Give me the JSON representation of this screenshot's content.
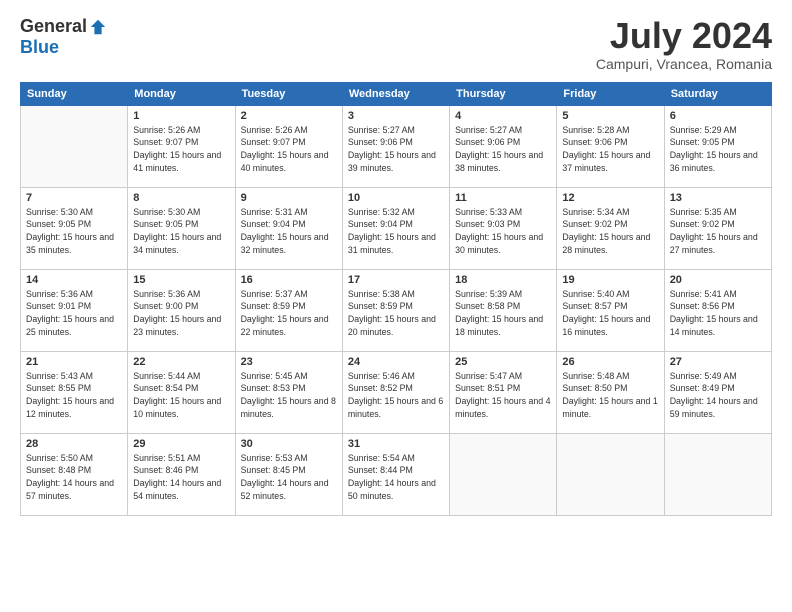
{
  "logo": {
    "general": "General",
    "blue": "Blue"
  },
  "title": "July 2024",
  "subtitle": "Campuri, Vrancea, Romania",
  "days_of_week": [
    "Sunday",
    "Monday",
    "Tuesday",
    "Wednesday",
    "Thursday",
    "Friday",
    "Saturday"
  ],
  "weeks": [
    [
      {
        "day": "",
        "sunrise": "",
        "sunset": "",
        "daylight": ""
      },
      {
        "day": "1",
        "sunrise": "Sunrise: 5:26 AM",
        "sunset": "Sunset: 9:07 PM",
        "daylight": "Daylight: 15 hours and 41 minutes."
      },
      {
        "day": "2",
        "sunrise": "Sunrise: 5:26 AM",
        "sunset": "Sunset: 9:07 PM",
        "daylight": "Daylight: 15 hours and 40 minutes."
      },
      {
        "day": "3",
        "sunrise": "Sunrise: 5:27 AM",
        "sunset": "Sunset: 9:06 PM",
        "daylight": "Daylight: 15 hours and 39 minutes."
      },
      {
        "day": "4",
        "sunrise": "Sunrise: 5:27 AM",
        "sunset": "Sunset: 9:06 PM",
        "daylight": "Daylight: 15 hours and 38 minutes."
      },
      {
        "day": "5",
        "sunrise": "Sunrise: 5:28 AM",
        "sunset": "Sunset: 9:06 PM",
        "daylight": "Daylight: 15 hours and 37 minutes."
      },
      {
        "day": "6",
        "sunrise": "Sunrise: 5:29 AM",
        "sunset": "Sunset: 9:05 PM",
        "daylight": "Daylight: 15 hours and 36 minutes."
      }
    ],
    [
      {
        "day": "7",
        "sunrise": "Sunrise: 5:30 AM",
        "sunset": "Sunset: 9:05 PM",
        "daylight": "Daylight: 15 hours and 35 minutes."
      },
      {
        "day": "8",
        "sunrise": "Sunrise: 5:30 AM",
        "sunset": "Sunset: 9:05 PM",
        "daylight": "Daylight: 15 hours and 34 minutes."
      },
      {
        "day": "9",
        "sunrise": "Sunrise: 5:31 AM",
        "sunset": "Sunset: 9:04 PM",
        "daylight": "Daylight: 15 hours and 32 minutes."
      },
      {
        "day": "10",
        "sunrise": "Sunrise: 5:32 AM",
        "sunset": "Sunset: 9:04 PM",
        "daylight": "Daylight: 15 hours and 31 minutes."
      },
      {
        "day": "11",
        "sunrise": "Sunrise: 5:33 AM",
        "sunset": "Sunset: 9:03 PM",
        "daylight": "Daylight: 15 hours and 30 minutes."
      },
      {
        "day": "12",
        "sunrise": "Sunrise: 5:34 AM",
        "sunset": "Sunset: 9:02 PM",
        "daylight": "Daylight: 15 hours and 28 minutes."
      },
      {
        "day": "13",
        "sunrise": "Sunrise: 5:35 AM",
        "sunset": "Sunset: 9:02 PM",
        "daylight": "Daylight: 15 hours and 27 minutes."
      }
    ],
    [
      {
        "day": "14",
        "sunrise": "Sunrise: 5:36 AM",
        "sunset": "Sunset: 9:01 PM",
        "daylight": "Daylight: 15 hours and 25 minutes."
      },
      {
        "day": "15",
        "sunrise": "Sunrise: 5:36 AM",
        "sunset": "Sunset: 9:00 PM",
        "daylight": "Daylight: 15 hours and 23 minutes."
      },
      {
        "day": "16",
        "sunrise": "Sunrise: 5:37 AM",
        "sunset": "Sunset: 8:59 PM",
        "daylight": "Daylight: 15 hours and 22 minutes."
      },
      {
        "day": "17",
        "sunrise": "Sunrise: 5:38 AM",
        "sunset": "Sunset: 8:59 PM",
        "daylight": "Daylight: 15 hours and 20 minutes."
      },
      {
        "day": "18",
        "sunrise": "Sunrise: 5:39 AM",
        "sunset": "Sunset: 8:58 PM",
        "daylight": "Daylight: 15 hours and 18 minutes."
      },
      {
        "day": "19",
        "sunrise": "Sunrise: 5:40 AM",
        "sunset": "Sunset: 8:57 PM",
        "daylight": "Daylight: 15 hours and 16 minutes."
      },
      {
        "day": "20",
        "sunrise": "Sunrise: 5:41 AM",
        "sunset": "Sunset: 8:56 PM",
        "daylight": "Daylight: 15 hours and 14 minutes."
      }
    ],
    [
      {
        "day": "21",
        "sunrise": "Sunrise: 5:43 AM",
        "sunset": "Sunset: 8:55 PM",
        "daylight": "Daylight: 15 hours and 12 minutes."
      },
      {
        "day": "22",
        "sunrise": "Sunrise: 5:44 AM",
        "sunset": "Sunset: 8:54 PM",
        "daylight": "Daylight: 15 hours and 10 minutes."
      },
      {
        "day": "23",
        "sunrise": "Sunrise: 5:45 AM",
        "sunset": "Sunset: 8:53 PM",
        "daylight": "Daylight: 15 hours and 8 minutes."
      },
      {
        "day": "24",
        "sunrise": "Sunrise: 5:46 AM",
        "sunset": "Sunset: 8:52 PM",
        "daylight": "Daylight: 15 hours and 6 minutes."
      },
      {
        "day": "25",
        "sunrise": "Sunrise: 5:47 AM",
        "sunset": "Sunset: 8:51 PM",
        "daylight": "Daylight: 15 hours and 4 minutes."
      },
      {
        "day": "26",
        "sunrise": "Sunrise: 5:48 AM",
        "sunset": "Sunset: 8:50 PM",
        "daylight": "Daylight: 15 hours and 1 minute."
      },
      {
        "day": "27",
        "sunrise": "Sunrise: 5:49 AM",
        "sunset": "Sunset: 8:49 PM",
        "daylight": "Daylight: 14 hours and 59 minutes."
      }
    ],
    [
      {
        "day": "28",
        "sunrise": "Sunrise: 5:50 AM",
        "sunset": "Sunset: 8:48 PM",
        "daylight": "Daylight: 14 hours and 57 minutes."
      },
      {
        "day": "29",
        "sunrise": "Sunrise: 5:51 AM",
        "sunset": "Sunset: 8:46 PM",
        "daylight": "Daylight: 14 hours and 54 minutes."
      },
      {
        "day": "30",
        "sunrise": "Sunrise: 5:53 AM",
        "sunset": "Sunset: 8:45 PM",
        "daylight": "Daylight: 14 hours and 52 minutes."
      },
      {
        "day": "31",
        "sunrise": "Sunrise: 5:54 AM",
        "sunset": "Sunset: 8:44 PM",
        "daylight": "Daylight: 14 hours and 50 minutes."
      },
      {
        "day": "",
        "sunrise": "",
        "sunset": "",
        "daylight": ""
      },
      {
        "day": "",
        "sunrise": "",
        "sunset": "",
        "daylight": ""
      },
      {
        "day": "",
        "sunrise": "",
        "sunset": "",
        "daylight": ""
      }
    ]
  ]
}
